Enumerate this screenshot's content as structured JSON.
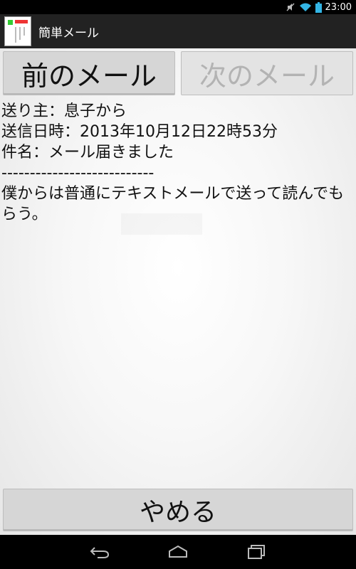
{
  "status_bar": {
    "time": "23:00",
    "icons": [
      "mute-icon",
      "wifi-icon",
      "battery-icon"
    ]
  },
  "action_bar": {
    "title": "簡単メール",
    "icon": "app-icon"
  },
  "nav_buttons": {
    "prev_label": "前のメール",
    "next_label": "次のメール",
    "next_enabled": false
  },
  "mail": {
    "sender_line": "送り主：息子から",
    "datetime_line": "送信日時：2013年10月12日22時53分",
    "subject_line": "件名：メール届きました",
    "separator": "---------------------------",
    "body": "僕からは普通にテキストメールで送って読んでもらう。"
  },
  "quit_button": {
    "label": "やめる"
  },
  "system_nav": {
    "icons": [
      "back-icon",
      "home-icon",
      "recent-apps-icon"
    ]
  },
  "colors": {
    "status_bar_bg": "#000000",
    "action_bar_bg": "#222222",
    "button_bg": "#d6d6d6",
    "disabled_text": "#b3b3b3"
  }
}
